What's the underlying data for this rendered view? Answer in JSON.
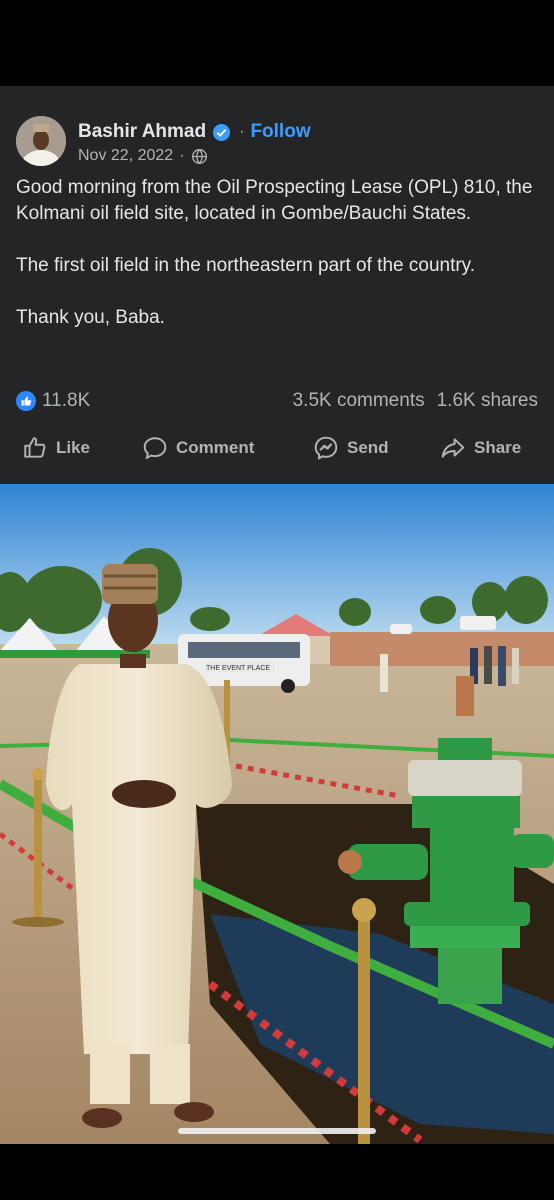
{
  "post": {
    "author": "Bashir Ahmad",
    "follow": "Follow",
    "date": "Nov 22, 2022",
    "meta_separator": "·",
    "body": [
      "Good morning from the Oil Prospecting Lease (OPL) 810, the Kolmani oil field site, located in Gombe/Bauchi States.",
      "The first oil field in the northeastern part of the country.",
      "Thank you, Baba."
    ],
    "reactions": "11.8K",
    "comments": "3.5K comments",
    "shares": "1.6K shares"
  },
  "actions": {
    "like": "Like",
    "comment": "Comment",
    "send": "Send",
    "share": "Share"
  },
  "photo": {
    "bus_sign": "THE EVENT PLACE"
  },
  "icons": {
    "verified": "verified-badge-icon",
    "audience": "globe-icon",
    "like": "thumbs-up-icon",
    "comment": "speech-bubble-icon",
    "send": "messenger-icon",
    "share": "share-arrow-icon"
  },
  "colors": {
    "card_bg": "#242526",
    "accent": "#3b9cff",
    "text": "#e4e6eb",
    "muted": "#b0b3b8"
  }
}
